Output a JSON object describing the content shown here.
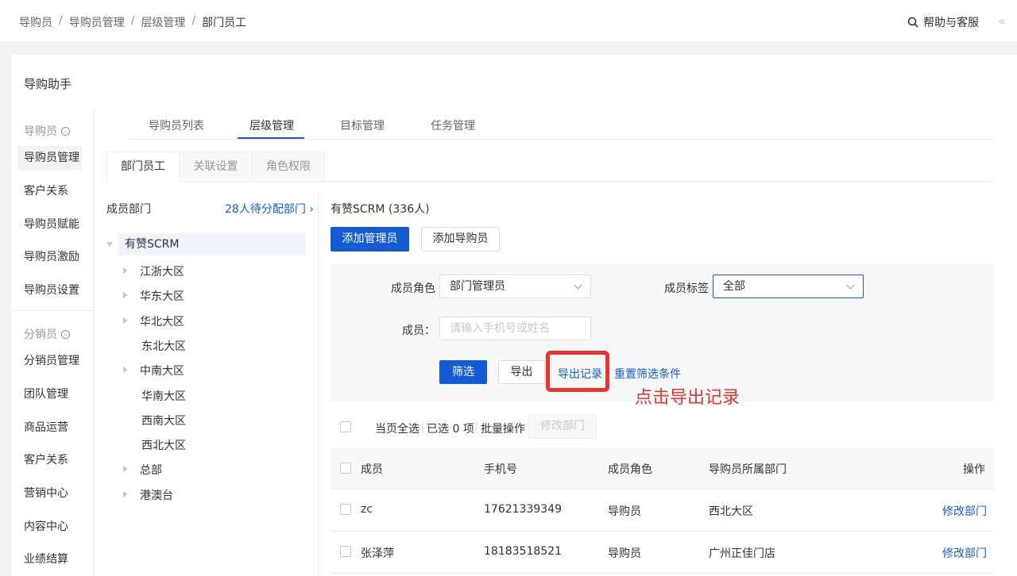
{
  "topbar": {
    "breadcrumb": [
      "导购员",
      "导购员管理",
      "层级管理",
      "部门员工"
    ],
    "separator": "/",
    "help_label": "帮助与客服",
    "collapse_glyph": "«"
  },
  "app_title": "导购助手",
  "leftnav": {
    "group1": "导购员",
    "group1_items": [
      "导购员管理",
      "客户关系",
      "导购员赋能",
      "导购员激励",
      "导购员设置"
    ],
    "group2": "分销员",
    "group2_items": [
      "分销员管理",
      "团队管理",
      "商品运营",
      "客户关系",
      "营销中心",
      "内容中心",
      "业绩结算"
    ]
  },
  "main_tabs": [
    "导购员列表",
    "层级管理",
    "目标管理",
    "任务管理"
  ],
  "sub_tabs": [
    "部门员工",
    "关联设置",
    "角色权限"
  ],
  "dept_panel": {
    "title": "成员部门",
    "unassigned_link": "28人待分配部门 ›",
    "root": "有赞SCRM",
    "nodes": [
      {
        "label": "江浙大区",
        "expandable": true
      },
      {
        "label": "华东大区",
        "expandable": true
      },
      {
        "label": "华北大区",
        "expandable": true
      },
      {
        "label": "东北大区",
        "expandable": false
      },
      {
        "label": "中南大区",
        "expandable": true
      },
      {
        "label": "华南大区",
        "expandable": false
      },
      {
        "label": "西南大区",
        "expandable": false
      },
      {
        "label": "西北大区",
        "expandable": false
      },
      {
        "label": "总部",
        "expandable": true
      },
      {
        "label": "港澳台",
        "expandable": true
      }
    ]
  },
  "org": {
    "title": "有赞SCRM (336人)",
    "add_admin": "添加管理员",
    "add_guide": "添加导购员"
  },
  "filter": {
    "role_label": "成员角色",
    "role_value": "部门管理员",
    "tag_label": "成员标签",
    "tag_value": "全部",
    "member_label": "成员：",
    "member_placeholder": "请输入手机号或姓名",
    "filter_btn": "筛选",
    "export_btn": "导出",
    "export_record": "导出记录",
    "reset": "重置筛选条件",
    "annotation": "点击导出记录",
    "highlight_color": "#e8352b"
  },
  "batch": {
    "select_page": "当页全选",
    "selected": "已选 0 项",
    "batch_ops": "批量操作",
    "modify_dept": "修改部门"
  },
  "table": {
    "headers": [
      "成员",
      "手机号",
      "成员角色",
      "导购员所属部门",
      "操作"
    ],
    "rows": [
      {
        "name": "zc",
        "phone": "17621339349",
        "role": "导购员",
        "dept": "西北大区",
        "action": "修改部门"
      },
      {
        "name": "张泽萍",
        "phone": "18183518521",
        "role": "导购员",
        "dept": "广州正佳门店",
        "action": "修改部门"
      }
    ]
  },
  "colors": {
    "primary": "#155bd4",
    "text": "#323233",
    "muted": "#969799",
    "annotation": "#e8352b"
  }
}
